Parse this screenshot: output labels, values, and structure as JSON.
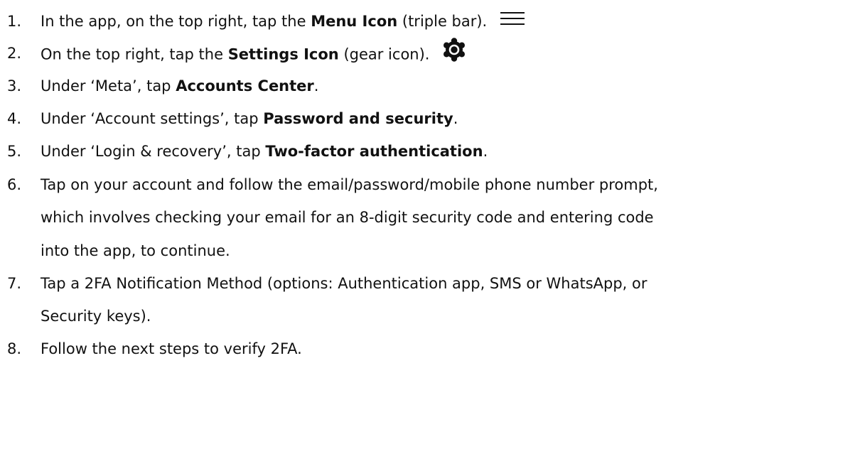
{
  "steps": [
    {
      "num": "1.",
      "pre": "In the app, on the top right, tap the ",
      "bold": "Menu Icon",
      "post": " (triple bar).",
      "icon": "menu-icon"
    },
    {
      "num": "2.",
      "pre": "On the top right, tap the ",
      "bold": "Settings Icon",
      "post": " (gear icon).",
      "icon": "gear-icon"
    },
    {
      "num": "3.",
      "pre": "Under ‘Meta’, tap ",
      "bold": "Accounts Center",
      "post": "."
    },
    {
      "num": "4.",
      "pre": "Under ‘Account settings’, tap ",
      "bold": "Password and security",
      "post": "."
    },
    {
      "num": "5.",
      "pre": "Under ‘Login & recovery’, tap ",
      "bold": "Two-factor authentication",
      "post": "."
    },
    {
      "num": "6.",
      "lines": [
        "Tap on your account and follow the email/password/mobile phone number prompt,",
        "which involves checking your email for an 8-digit security code and entering code",
        "into the app, to continue."
      ]
    },
    {
      "num": "7.",
      "lines": [
        "Tap a 2FA Notification Method (options: Authentication app, SMS or WhatsApp, or",
        "Security keys)."
      ]
    },
    {
      "num": "8.",
      "text": "Follow the next steps to verify 2FA."
    }
  ]
}
